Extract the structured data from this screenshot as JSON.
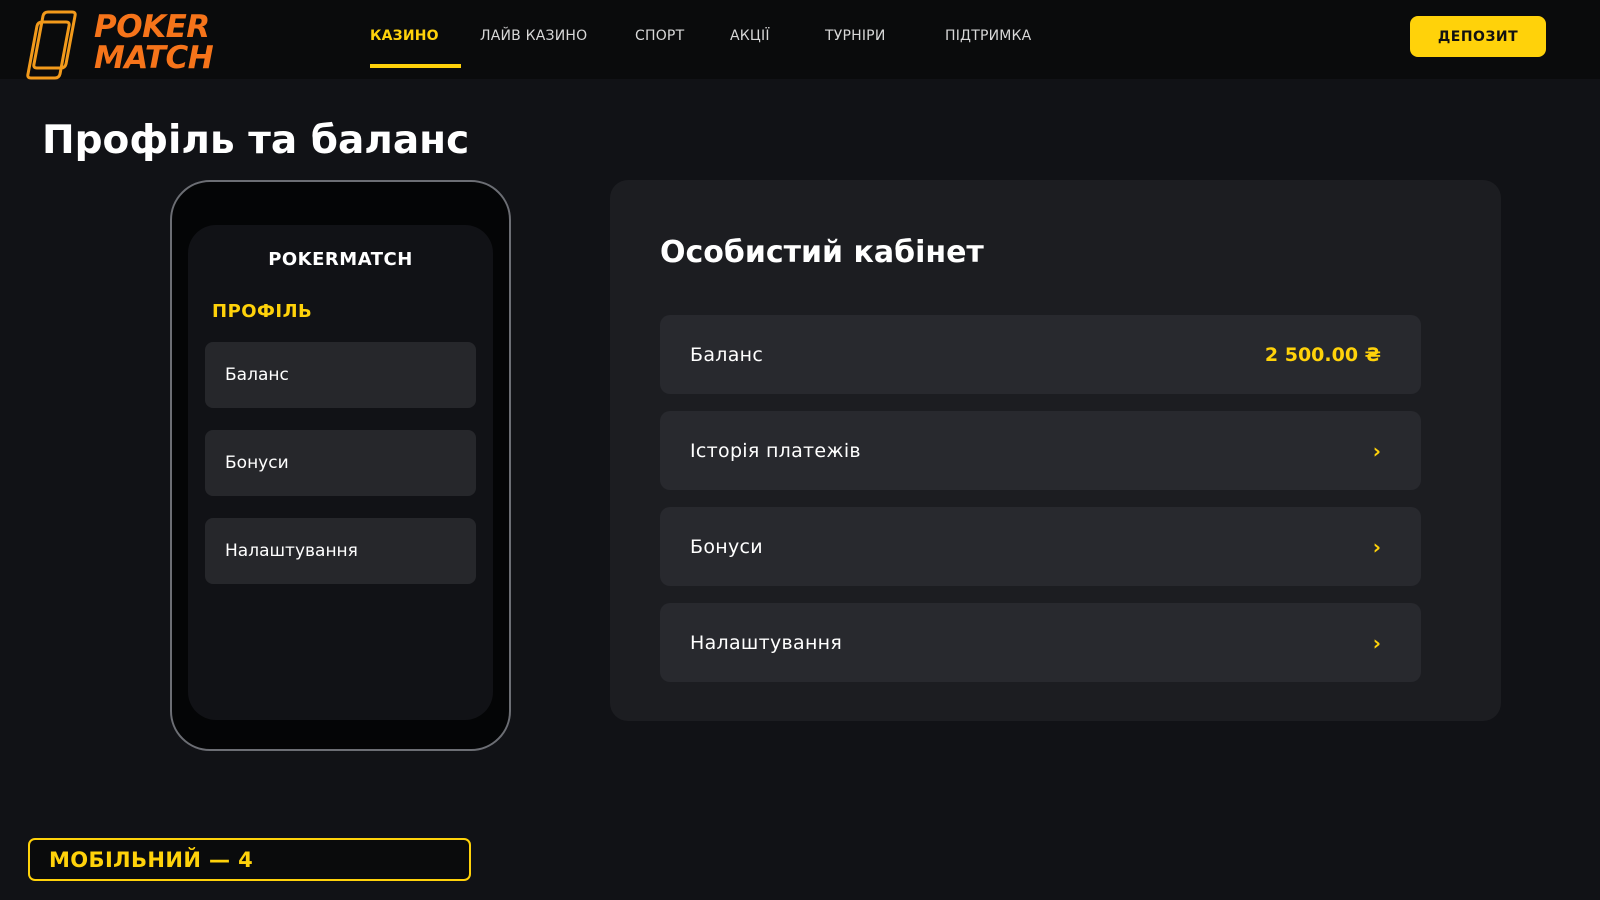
{
  "brand": {
    "logo_line1": "POKER",
    "logo_line2": "MATCH",
    "accent": "#ffd20a",
    "logo_color": "#f6741a"
  },
  "nav": {
    "items": [
      {
        "label": "КАЗИНО",
        "active": true
      },
      {
        "label": "ЛАЙВ КАЗИНО",
        "active": false
      },
      {
        "label": "СПОРТ",
        "active": false
      },
      {
        "label": "АКЦІЇ",
        "active": false
      },
      {
        "label": "ТУРНІРИ",
        "active": false
      },
      {
        "label": "ПІДТРИМКА",
        "active": false
      }
    ],
    "deposit_label": "ДЕПОЗИТ"
  },
  "page": {
    "title": "Профіль та баланс"
  },
  "phone": {
    "brand": "POKERMATCH",
    "section": "ПРОФІЛЬ",
    "items": [
      "Баланс",
      "Бонуси",
      "Налаштування"
    ]
  },
  "panel": {
    "title": "Особистий кабінет",
    "balance": {
      "label": "Баланс",
      "value": "2 500.00 ₴"
    },
    "rows": [
      {
        "label": "Історія платежів",
        "icon": "chevron-right-icon",
        "glyph": "›"
      },
      {
        "label": "Бонуси",
        "icon": "chevron-right-icon",
        "glyph": "›"
      },
      {
        "label": "Налаштування",
        "icon": "chevron-right-icon",
        "glyph": "›"
      }
    ]
  },
  "footer_badge": {
    "label": "МОБІЛЬНИЙ — 4"
  }
}
